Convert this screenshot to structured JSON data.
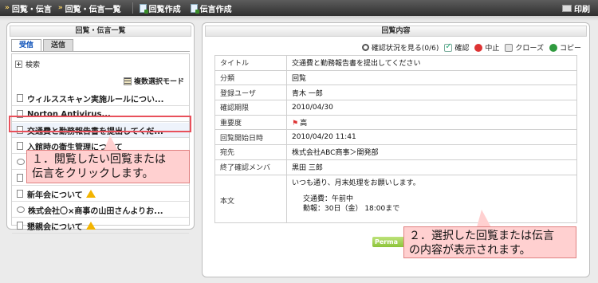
{
  "topbar": {
    "crumb1": "回覧・伝言",
    "crumb2": "回覧・伝言一覧",
    "btn_create_circular": "回覧作成",
    "btn_create_message": "伝言作成",
    "print": "印刷"
  },
  "left": {
    "title": "回覧・伝言一覧",
    "tab_in": "受信",
    "tab_out": "送信",
    "search": "検索",
    "multi_select": "複数選択モード",
    "items": [
      {
        "type": "page",
        "label": "ウィルススキャン実施ルールについ...",
        "warn": false
      },
      {
        "type": "page",
        "label": "Norton Antivirus...",
        "warn": false
      },
      {
        "type": "page",
        "label": "交通費と勤務報告書を提出してくだ...",
        "warn": false
      },
      {
        "type": "page",
        "label": "入館時の衛生管理について",
        "warn": false
      },
      {
        "type": "bubble",
        "label": "",
        "warn": false
      },
      {
        "type": "page",
        "label": "",
        "warn": false
      },
      {
        "type": "page",
        "label": "新年会について",
        "warn": true
      },
      {
        "type": "bubble",
        "label": "株式会社〇×商事の山田さんよりお...",
        "warn": false
      },
      {
        "type": "page",
        "label": "懇親会について",
        "warn": true
      }
    ]
  },
  "right": {
    "title": "回覧内容",
    "actions": {
      "status": "確認状況を見る(0/6)",
      "confirm": "確認",
      "stop": "中止",
      "close": "クローズ",
      "copy": "コピー"
    },
    "rows": [
      {
        "key": "タイトル",
        "value": "交通費と勤務報告書を提出してください"
      },
      {
        "key": "分類",
        "value": "回覧"
      },
      {
        "key": "登録ユーザ",
        "value": "青木 一郎"
      },
      {
        "key": "確認期限",
        "value": "2010/04/30"
      },
      {
        "key": "重要度",
        "value": "高"
      },
      {
        "key": "回覧開始日時",
        "value": "2010/04/20 11:41"
      },
      {
        "key": "宛先",
        "value": "株式会社ABC商事＞開発部"
      },
      {
        "key": "終了確認メンバ",
        "value": "黒田 三郎"
      }
    ],
    "body_key": "本文",
    "body_line1": "いつも通り、月末処理をお願いします。",
    "body_line2": "交通費：午前中",
    "body_line3": "勤報：30日（金） 18:00まで",
    "perm_label": "Perma"
  },
  "callouts": {
    "c1_line1": "１．閲覧したい回覧または",
    "c1_line2": "伝言をクリックします。",
    "c2_line1": "２．選択した回覧または伝言",
    "c2_line2": "の内容が表示されます。"
  },
  "colors": {
    "highlight": "#e8505b",
    "callout_bg": "#ffd0d0",
    "tab_active": "#0b50b8"
  }
}
